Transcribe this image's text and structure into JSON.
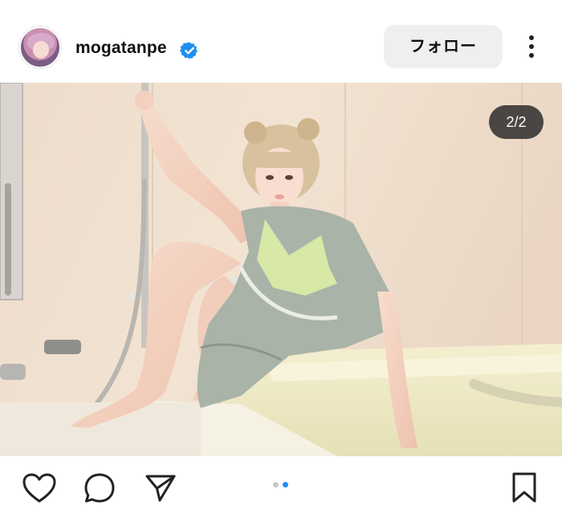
{
  "post": {
    "username": "mogatanpe",
    "verified": true,
    "follow_label": "フォロー",
    "image_counter": "2/2",
    "current_image": 2,
    "total_images": 2
  },
  "icons": {
    "verified": "verified-badge-icon",
    "more": "more-options-icon",
    "like": "heart-icon",
    "comment": "comment-icon",
    "share": "send-icon",
    "save": "bookmark-icon"
  },
  "colors": {
    "verified_blue": "#1e90f0",
    "active_dot": "#1e8ff5",
    "inactive_dot": "#c7c7c7",
    "follow_bg": "#efefef"
  }
}
